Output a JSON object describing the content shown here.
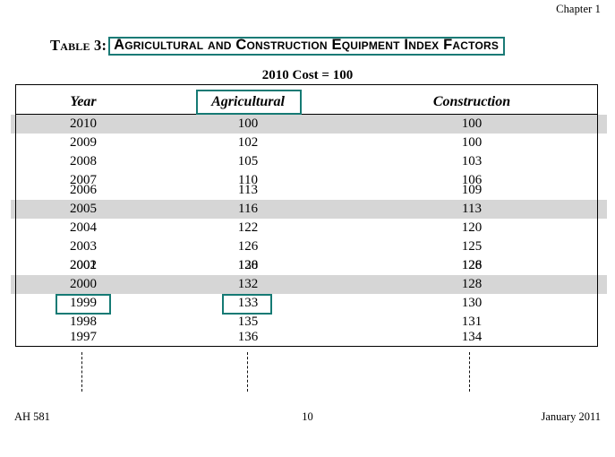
{
  "page": {
    "chapter_header": "Chapter 1"
  },
  "table": {
    "label": "Table 3:",
    "title": "Agricultural and Construction Equipment Index Factors",
    "subtitle": "2010 Cost = 100",
    "columns": [
      "Year",
      "Agricultural",
      "Construction"
    ],
    "rows": [
      {
        "year": "2010",
        "agricultural": "100",
        "construction": "100",
        "shaded": true
      },
      {
        "year": "2009",
        "agricultural": "102",
        "construction": "100",
        "shaded": false
      },
      {
        "year": "2008",
        "agricultural": "105",
        "construction": "103",
        "shaded": false
      },
      {
        "year": "2007",
        "agricultural": "110",
        "construction": "106",
        "shaded": false
      },
      {
        "year": "2006",
        "agricultural": "113",
        "construction": "109",
        "shaded": false
      },
      {
        "year": "2005",
        "agricultural": "116",
        "construction": "113",
        "shaded": true
      },
      {
        "year": "2004",
        "agricultural": "122",
        "construction": "120",
        "shaded": false
      },
      {
        "year": "2003",
        "agricultural": "126",
        "construction": "125",
        "shaded": false
      },
      {
        "year": "2002",
        "agricultural": "128",
        "construction": "126",
        "shaded": false
      },
      {
        "year": "2001",
        "agricultural": "130",
        "construction": "128",
        "shaded": false
      },
      {
        "year": "2000",
        "agricultural": "132",
        "construction": "128",
        "shaded": true
      },
      {
        "year": "1999",
        "agricultural": "133",
        "construction": "130",
        "shaded": false
      },
      {
        "year": "1998",
        "agricultural": "135",
        "construction": "131",
        "shaded": false
      },
      {
        "year": "1997",
        "agricultural": "136",
        "construction": "134",
        "shaded": false
      }
    ],
    "continuation_marker": "vertical-dashed-ellipsis"
  },
  "highlights": {
    "color": "#157a74",
    "boxes": [
      {
        "name": "title",
        "text": "Agricultural and Construction Equipment Index Factors"
      },
      {
        "name": "column-header",
        "text": "Agricultural"
      },
      {
        "name": "year-cell",
        "text": "1999"
      },
      {
        "name": "value-cell",
        "text": "133"
      }
    ]
  },
  "footer": {
    "left": "AH 581",
    "center": "10",
    "right": "January 2011"
  }
}
